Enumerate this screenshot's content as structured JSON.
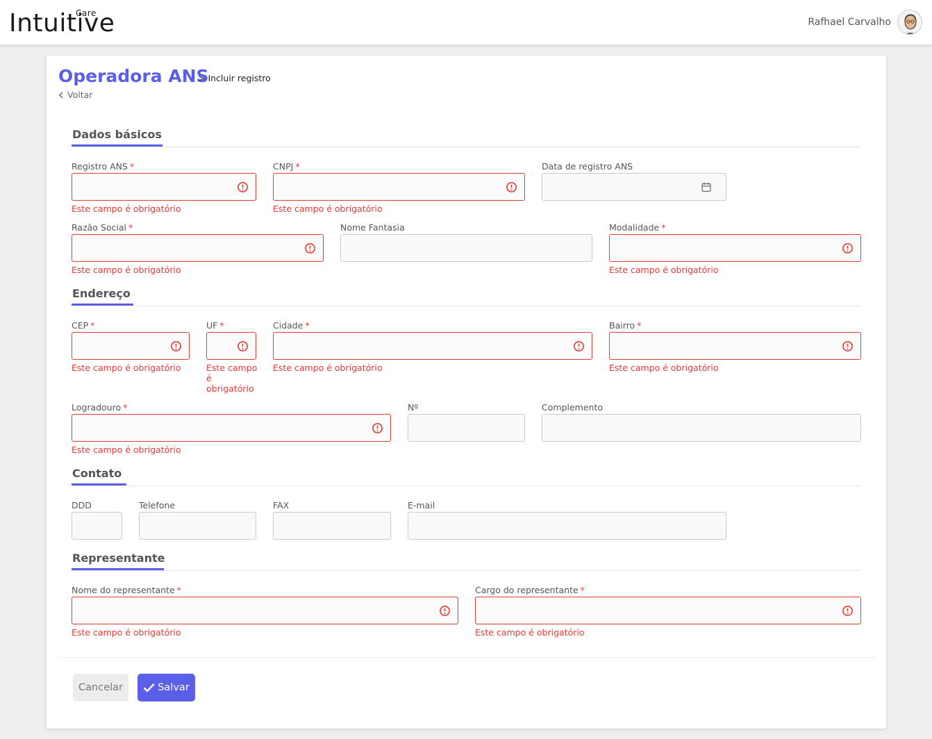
{
  "brand": {
    "name": "Intuitive",
    "superscript": "Care"
  },
  "user": {
    "name": "Rafhael Carvalho"
  },
  "header": {
    "title": "Operadora ANS",
    "breadcrumb": "> Incluir registro",
    "back": "Voltar"
  },
  "sections": {
    "basic": "Dados básicos",
    "address": "Endereço",
    "contact": "Contato",
    "rep": "Representante"
  },
  "fields": {
    "registro_ans": {
      "label": "Registro ANS",
      "required": "*",
      "value": ""
    },
    "cnpj": {
      "label": "CNPJ",
      "required": "*",
      "value": ""
    },
    "data_registro": {
      "label": "Data de registro ANS",
      "value": ""
    },
    "razao_social": {
      "label": "Razão Social",
      "required": "*",
      "value": ""
    },
    "nome_fantasia": {
      "label": "Nome Fantasia",
      "value": ""
    },
    "modalidade": {
      "label": "Modalidade",
      "required": "*",
      "value": ""
    },
    "cep": {
      "label": "CEP",
      "required": "*",
      "value": ""
    },
    "uf": {
      "label": "UF",
      "required": "*",
      "value": ""
    },
    "cidade": {
      "label": "Cidade",
      "required": "*",
      "value": ""
    },
    "bairro": {
      "label": "Bairro",
      "required": "*",
      "value": ""
    },
    "logradouro": {
      "label": "Logradouro",
      "required": "*",
      "value": ""
    },
    "numero": {
      "label": "Nº",
      "value": ""
    },
    "complemento": {
      "label": "Complemento",
      "value": ""
    },
    "ddd": {
      "label": "DDD",
      "value": ""
    },
    "telefone": {
      "label": "Telefone",
      "value": ""
    },
    "fax": {
      "label": "FAX",
      "value": ""
    },
    "email": {
      "label": "E-mail",
      "value": ""
    },
    "nome_rep": {
      "label": "Nome do representante",
      "required": "*",
      "value": ""
    },
    "cargo_rep": {
      "label": "Cargo do representante",
      "required": "*",
      "value": ""
    }
  },
  "error_message": "Este campo é obrigatório",
  "buttons": {
    "cancel": "Cancelar",
    "save": "Salvar"
  },
  "colors": {
    "accent": "#5b5fe8",
    "error": "#e53935"
  },
  "icons": {
    "field_error": "alert-circle-icon",
    "date": "calendar-icon",
    "back": "chevron-left-icon",
    "save": "check-icon"
  }
}
